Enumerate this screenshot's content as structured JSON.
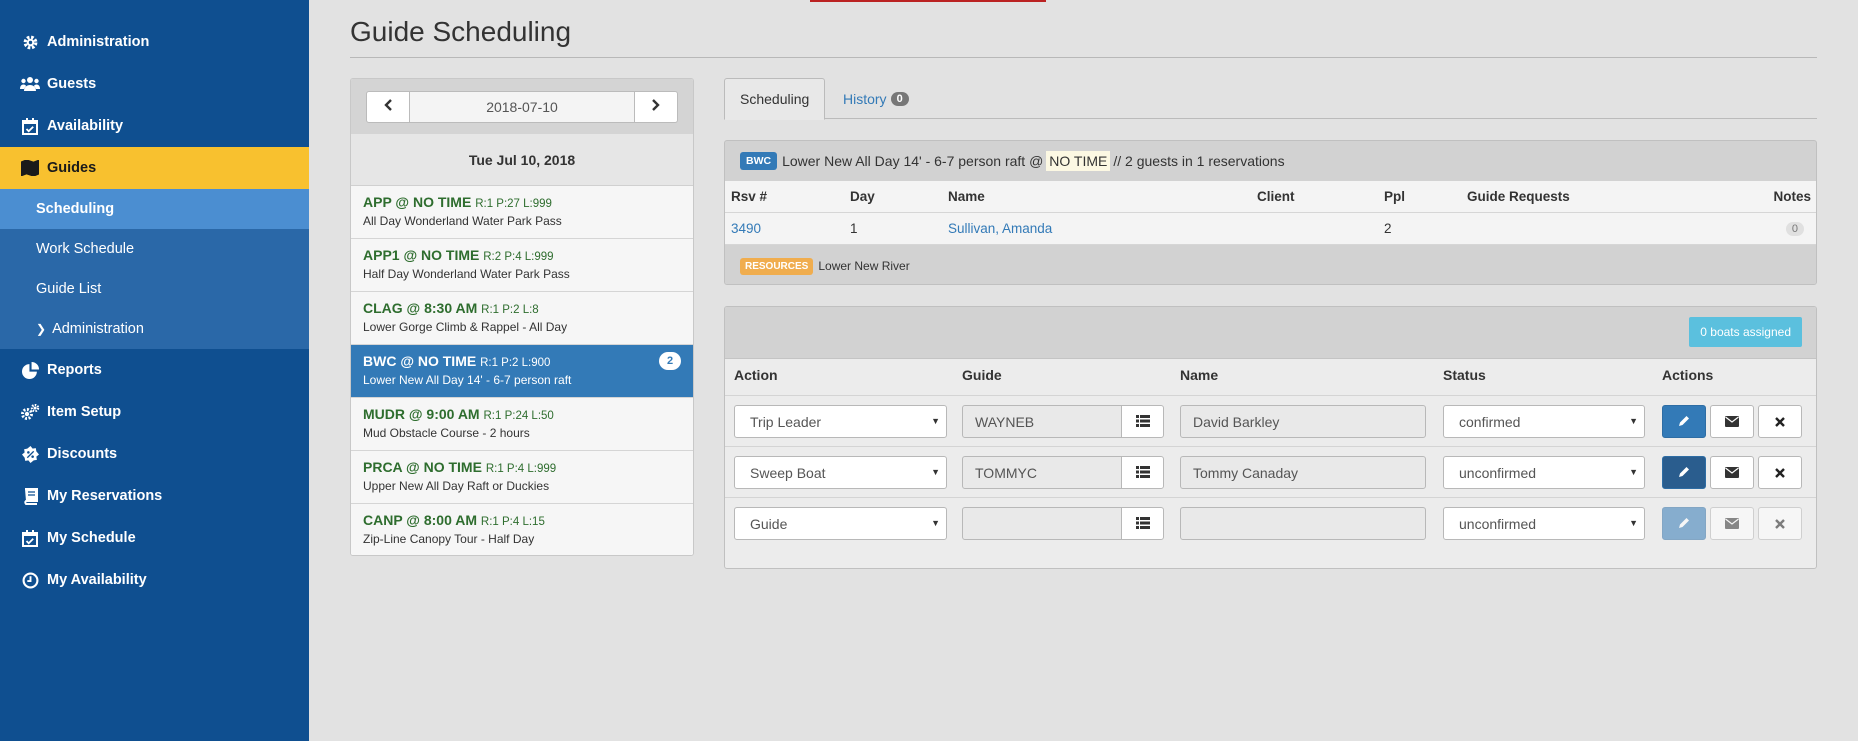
{
  "sidebar": {
    "items": [
      {
        "label": "Administration",
        "icon": "gear-icon"
      },
      {
        "label": "Guests",
        "icon": "users-icon"
      },
      {
        "label": "Availability",
        "icon": "calendar-check-icon"
      },
      {
        "label": "Guides",
        "icon": "map-icon"
      },
      {
        "label": "Reports",
        "icon": "pie-chart-icon"
      },
      {
        "label": "Item Setup",
        "icon": "gears-icon"
      },
      {
        "label": "Discounts",
        "icon": "percent-icon"
      },
      {
        "label": "My Reservations",
        "icon": "book-icon"
      },
      {
        "label": "My Schedule",
        "icon": "calendar-check-icon"
      },
      {
        "label": "My Availability",
        "icon": "clock-icon"
      }
    ],
    "guides_sub": [
      {
        "label": "Scheduling"
      },
      {
        "label": "Work Schedule"
      },
      {
        "label": "Guide List"
      },
      {
        "label": "Administration"
      }
    ],
    "accent_color": "#f8c12f",
    "bg_color": "#0f4f90"
  },
  "page": {
    "title": "Guide Scheduling"
  },
  "date_panel": {
    "date_value": "2018-07-10",
    "heading": "Tue Jul 10, 2018",
    "trips": [
      {
        "code": "APP @ NO TIME",
        "meta": "R:1 P:27 L:999",
        "desc": "All Day Wonderland Water Park Pass"
      },
      {
        "code": "APP1 @ NO TIME",
        "meta": "R:2 P:4 L:999",
        "desc": "Half Day Wonderland Water Park Pass"
      },
      {
        "code": "CLAG @ 8:30 AM",
        "meta": "R:1 P:2 L:8",
        "desc": "Lower Gorge Climb & Rappel - All Day"
      },
      {
        "code": "BWC @ NO TIME",
        "meta": "R:1 P:2 L:900",
        "desc": "Lower New All Day 14' - 6-7 person raft",
        "badge": "2"
      },
      {
        "code": "MUDR @ 9:00 AM",
        "meta": "R:1 P:24 L:50",
        "desc": "Mud Obstacle Course - 2 hours"
      },
      {
        "code": "PRCA @ NO TIME",
        "meta": "R:1 P:4 L:999",
        "desc": "Upper New All Day Raft or Duckies"
      },
      {
        "code": "CANP @ 8:00 AM",
        "meta": "R:1 P:4 L:15",
        "desc": "Zip-Line Canopy Tour - Half Day"
      }
    ]
  },
  "tabs": {
    "scheduling": "Scheduling",
    "history": "History",
    "history_count": "0"
  },
  "reservation": {
    "trip_label": "BWC",
    "trip_name": "Lower New All Day 14' - 6-7 person raft @",
    "time": "NO TIME",
    "summary": "// 2 guests in 1 reservations",
    "columns": [
      "Rsv #",
      "Day",
      "Name",
      "Client",
      "Ppl",
      "Guide Requests",
      "Notes"
    ],
    "rows": [
      {
        "rsv": "3490",
        "day": "1",
        "name": "Sullivan, Amanda",
        "client": "",
        "ppl": "2",
        "requests": "",
        "notes": "0"
      }
    ],
    "resources_label": "RESOURCES",
    "resources": "Lower New River"
  },
  "assignments": {
    "boats_button": "0 boats assigned",
    "columns": [
      "Action",
      "Guide",
      "Name",
      "Status",
      "Actions"
    ],
    "rows": [
      {
        "action": "Trip Leader",
        "guide": "WAYNEB",
        "name": "David Barkley",
        "status": "confirmed"
      },
      {
        "action": "Sweep Boat",
        "guide": "TOMMYC",
        "name": "Tommy Canaday",
        "status": "unconfirmed"
      },
      {
        "action": "Guide",
        "guide": "",
        "name": "",
        "status": "unconfirmed"
      }
    ]
  }
}
